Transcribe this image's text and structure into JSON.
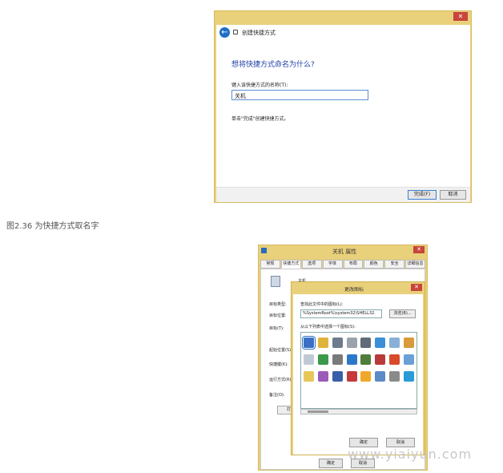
{
  "wizard": {
    "header": "创建快捷方式",
    "question": "想将快捷方式命名为什么?",
    "label": "键入该快捷方式的名称(T):",
    "value": "关机",
    "hint": "单击\"完成\"创建快捷方式。",
    "finish": "完成(F)",
    "cancel": "取消"
  },
  "caption": "图2.36 为快捷方式取名字",
  "props": {
    "title": "关机 属性",
    "tabs": [
      "常规",
      "快捷方式",
      "选项",
      "字体",
      "布局",
      "颜色",
      "安全",
      "详细信息"
    ],
    "name": "关机",
    "fields": [
      "目标类型:",
      "目标位置:",
      "目标(T):",
      "起始位置(S):",
      "快捷键(K):",
      "运行方式(R):",
      "备注(O):"
    ],
    "open_btn": "打开",
    "ok": "确定",
    "cancel": "取消"
  },
  "dialog": {
    "title": "更改图标",
    "label1": "查找此文件中的图标(L):",
    "path": "%SystemRoot%\\system32\\SHELL32.",
    "browse": "浏览(B)...",
    "label2": "从以下列表中选择一个图标(S):",
    "ok": "确定",
    "cancel": "取消"
  },
  "watermark": "www.yiaiyun.com",
  "icon_colors": [
    "#3a6fc4",
    "#e0b43a",
    "#6d7b8c",
    "#9aa3ad",
    "#5f6b78",
    "#3b8fd6",
    "#8bb0d8",
    "#d89a3a",
    "#c0cad6",
    "#3a9a4a",
    "#7a7a7a",
    "#2b78c9",
    "#4f7d3a",
    "#b83a3a",
    "#d84a2a",
    "#6aa0d8",
    "#e8c65a",
    "#9b5ab8",
    "#3a5fa8",
    "#c43a3a",
    "#f0a82a",
    "#5a8ac8",
    "#8a8a8a",
    "#2a9ad8"
  ]
}
